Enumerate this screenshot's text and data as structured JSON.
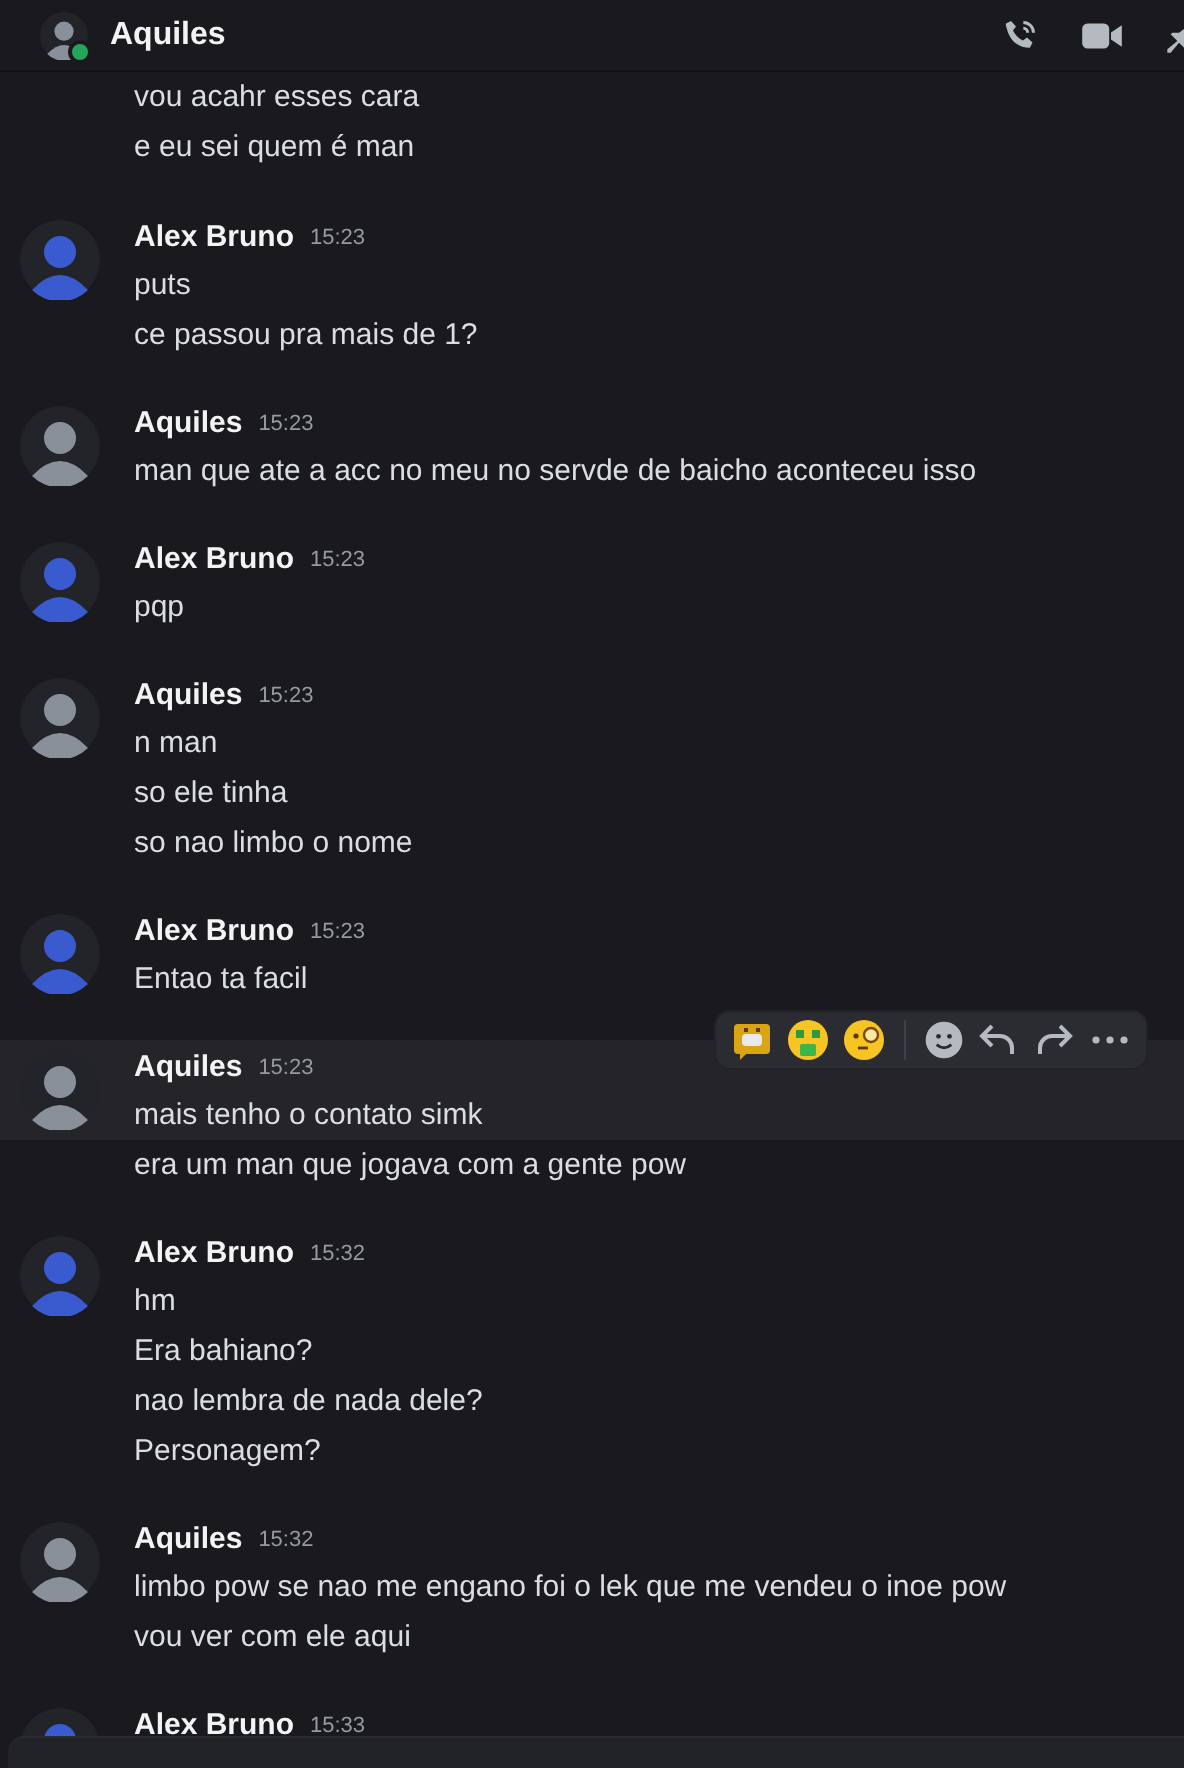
{
  "header": {
    "title": "Aquiles",
    "online": true
  },
  "groups": [
    {
      "messages": [
        {
          "text": "vou acahr esses cara",
          "highlighted": false
        },
        {
          "text": "e eu sei quem é man",
          "highlighted": false
        }
      ]
    },
    {
      "author": "Alex Bruno",
      "time": "15:23",
      "color": "#3a5bd0",
      "messages": [
        {
          "text": "puts",
          "highlighted": false
        },
        {
          "text": "ce passou pra mais de 1?",
          "highlighted": false
        }
      ]
    },
    {
      "author": "Aquiles",
      "time": "15:23",
      "color": "#8a9099",
      "messages": [
        {
          "text": "man que ate a acc no meu no servde de baicho aconteceu isso",
          "highlighted": false
        }
      ]
    },
    {
      "author": "Alex Bruno",
      "time": "15:23",
      "color": "#3a5bd0",
      "messages": [
        {
          "text": "pqp",
          "highlighted": false
        }
      ]
    },
    {
      "author": "Aquiles",
      "time": "15:23",
      "color": "#8a9099",
      "messages": [
        {
          "text": "n man",
          "highlighted": false
        },
        {
          "text": "so ele tinha",
          "highlighted": false
        },
        {
          "text": "so nao limbo o nome",
          "highlighted": false
        }
      ]
    },
    {
      "author": "Alex Bruno",
      "time": "15:23",
      "color": "#3a5bd0",
      "messages": [
        {
          "text": "Entao ta facil",
          "highlighted": false
        }
      ]
    },
    {
      "author": "Aquiles",
      "time": "15:23",
      "color": "#8a9099",
      "messages": [
        {
          "text": "mais tenho o contato simk",
          "highlighted": true
        },
        {
          "text": "era um man que jogava com a gente pow",
          "highlighted": false
        }
      ]
    },
    {
      "author": "Alex Bruno",
      "time": "15:32",
      "color": "#3a5bd0",
      "messages": [
        {
          "text": "hm",
          "highlighted": false
        },
        {
          "text": "Era bahiano?",
          "highlighted": false
        },
        {
          "text": "nao lembra de nada dele?",
          "highlighted": false
        },
        {
          "text": "Personagem?",
          "highlighted": false
        }
      ]
    },
    {
      "author": "Aquiles",
      "time": "15:32",
      "color": "#8a9099",
      "messages": [
        {
          "text": "limbo pow se nao me engano foi o lek que me vendeu o inoe pow",
          "highlighted": false
        },
        {
          "text": "vou ver com ele aqui",
          "highlighted": false
        }
      ]
    },
    {
      "author": "Alex Bruno",
      "time": "15:33",
      "color": "#3a5bd0"
    }
  ]
}
